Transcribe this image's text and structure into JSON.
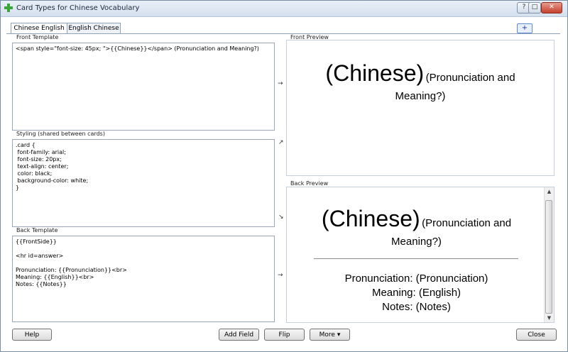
{
  "window": {
    "title": "Card Types for Chinese Vocabulary",
    "controls": [
      "?",
      "□",
      "✕"
    ]
  },
  "tabs": [
    {
      "label": "Chinese English",
      "active": true
    },
    {
      "label": "English Chinese",
      "active": false
    }
  ],
  "add_tab_label": "+",
  "front_template": {
    "label": "Front Template",
    "value": "<span style=\"font-size: 45px; \">{{Chinese}}</span> (Pronunciation and Meaning?)"
  },
  "styling": {
    "label": "Styling (shared between cards)",
    "value": ".card {\n font-family: arial;\n font-size: 20px;\n text-align: center;\n color: black;\n background-color: white;\n}"
  },
  "back_template": {
    "label": "Back Template",
    "value": "{{FrontSide}}\n\n<hr id=answer>\n\nPronunciation: {{Pronunciation}}<br>\nMeaning: {{English}}<br>\nNotes: {{Notes}}"
  },
  "arrows": {
    "front": "→",
    "styling_up": "↗",
    "styling_down": "↘",
    "back": "→"
  },
  "front_preview": {
    "label": "Front Preview",
    "big": "(Chinese)",
    "small": "(Pronunciation and",
    "line2": "Meaning?)"
  },
  "back_preview": {
    "label": "Back Preview",
    "big": "(Chinese)",
    "small": "(Pronunciation and",
    "line2": "Meaning?)",
    "answer_lines": [
      "Pronunciation: (Pronunciation)",
      "Meaning: (English)",
      "Notes: (Notes)"
    ]
  },
  "buttons": {
    "help": "Help",
    "add_field": "Add Field",
    "flip": "Flip",
    "more": "More ▾",
    "close": "Close"
  },
  "colors": {
    "accent": "#5c8bd1",
    "titlebar": "#d5e0ee",
    "border": "#9aa7b8"
  }
}
